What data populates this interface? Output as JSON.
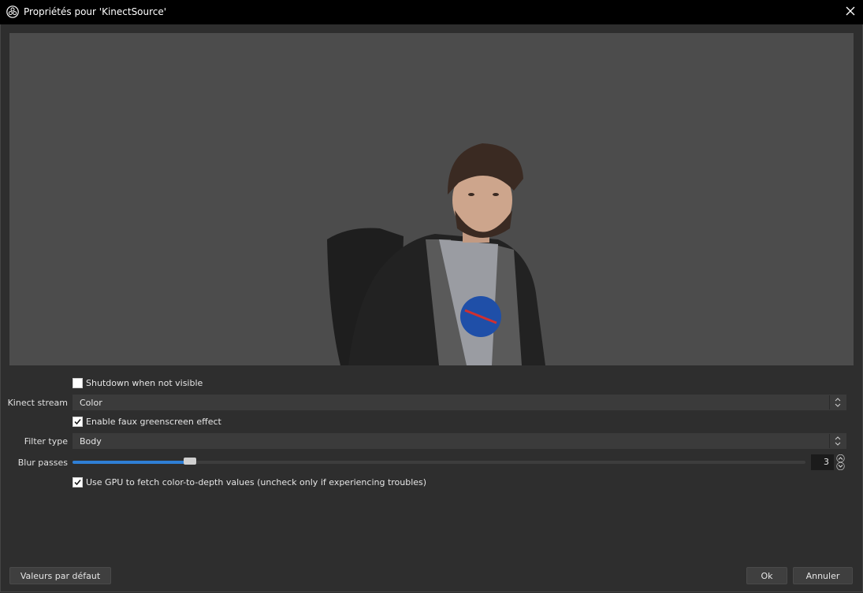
{
  "window": {
    "title": "Propriétés pour 'KinectSource'",
    "app_icon": "obs-logo-icon",
    "close_icon": "close-icon"
  },
  "properties": {
    "shutdown": {
      "label": "Shutdown when not visible",
      "checked": false
    },
    "kinect_stream": {
      "label": "Kinect stream",
      "value": "Color"
    },
    "greenscreen": {
      "label": "Enable faux greenscreen effect",
      "checked": true
    },
    "filter_type": {
      "label": "Filter type",
      "value": "Body"
    },
    "blur_passes": {
      "label": "Blur passes",
      "value": "3",
      "slider_fraction": 0.16
    },
    "gpu": {
      "label": "Use GPU to fetch color-to-depth values (uncheck only if experiencing troubles)",
      "checked": true
    }
  },
  "buttons": {
    "defaults": "Valeurs par défaut",
    "ok": "Ok",
    "cancel": "Annuler"
  },
  "colors": {
    "accent": "#2f7fd6",
    "background": "#2e2e2e",
    "preview_background": "#4c4c4c"
  }
}
